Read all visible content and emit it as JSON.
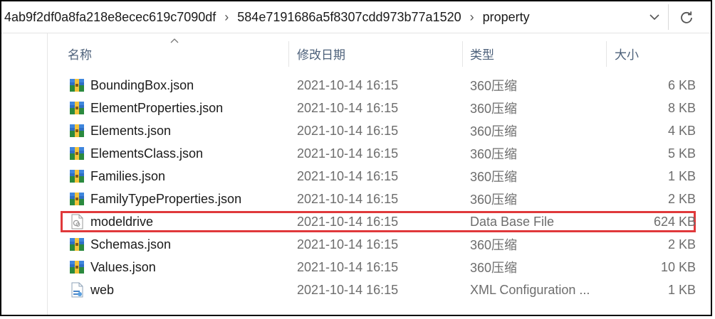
{
  "address": {
    "crumbs": [
      "4ab9f2df0a8fa218e8ecec619c7090df",
      "584e7191686a5f8307cdd973b77a1520",
      "property"
    ]
  },
  "columns": {
    "name": "名称",
    "date": "修改日期",
    "type": "类型",
    "size": "大小"
  },
  "files": [
    {
      "name": "BoundingBox.json",
      "date": "2021-10-14 16:15",
      "type": "360压缩",
      "size": "6 KB",
      "icon": "archive-icon"
    },
    {
      "name": "ElementProperties.json",
      "date": "2021-10-14 16:15",
      "type": "360压缩",
      "size": "8 KB",
      "icon": "archive-icon"
    },
    {
      "name": "Elements.json",
      "date": "2021-10-14 16:15",
      "type": "360压缩",
      "size": "4 KB",
      "icon": "archive-icon"
    },
    {
      "name": "ElementsClass.json",
      "date": "2021-10-14 16:15",
      "type": "360压缩",
      "size": "5 KB",
      "icon": "archive-icon"
    },
    {
      "name": "Families.json",
      "date": "2021-10-14 16:15",
      "type": "360压缩",
      "size": "1 KB",
      "icon": "archive-icon"
    },
    {
      "name": "FamilyTypeProperties.json",
      "date": "2021-10-14 16:15",
      "type": "360压缩",
      "size": "2 KB",
      "icon": "archive-icon"
    },
    {
      "name": "modeldrive",
      "date": "2021-10-14 16:15",
      "type": "Data Base File",
      "size": "624 KB",
      "icon": "database-file-icon",
      "highlighted": true
    },
    {
      "name": "Schemas.json",
      "date": "2021-10-14 16:15",
      "type": "360压缩",
      "size": "2 KB",
      "icon": "archive-icon"
    },
    {
      "name": "Values.json",
      "date": "2021-10-14 16:15",
      "type": "360压缩",
      "size": "10 KB",
      "icon": "archive-icon"
    },
    {
      "name": "web",
      "date": "2021-10-14 16:15",
      "type": "XML Configuration ...",
      "size": "1 KB",
      "icon": "xml-config-icon"
    }
  ],
  "colors": {
    "highlight": "#e0393b",
    "header_text": "#4c607a"
  }
}
